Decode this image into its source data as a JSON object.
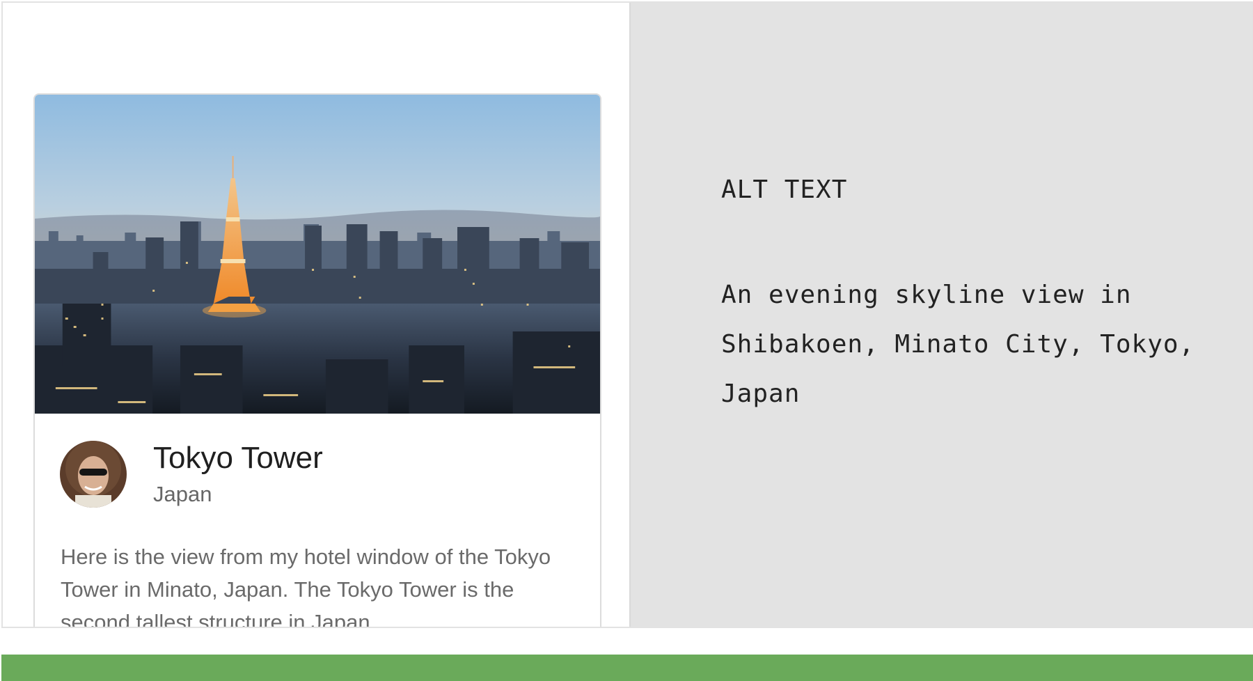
{
  "card": {
    "title": "Tokyo Tower",
    "subtitle": "Japan",
    "body": "Here is the view from my hotel window of the Tokyo Tower in Minato, Japan. The Tokyo Tower is the second tallest structure in Japan."
  },
  "alt_panel": {
    "heading": "ALT TEXT",
    "text": "An evening skyline view in Shibakoen, Minato City, Tokyo, Japan"
  },
  "icons": {
    "photo": "city-skyline-photo",
    "avatar": "user-avatar-photo"
  },
  "colors": {
    "alt_panel_bg": "#e3e3e3",
    "bottom_bar": "#6aaa5a",
    "title_text": "#1f1f1f",
    "secondary_text": "#666666"
  }
}
